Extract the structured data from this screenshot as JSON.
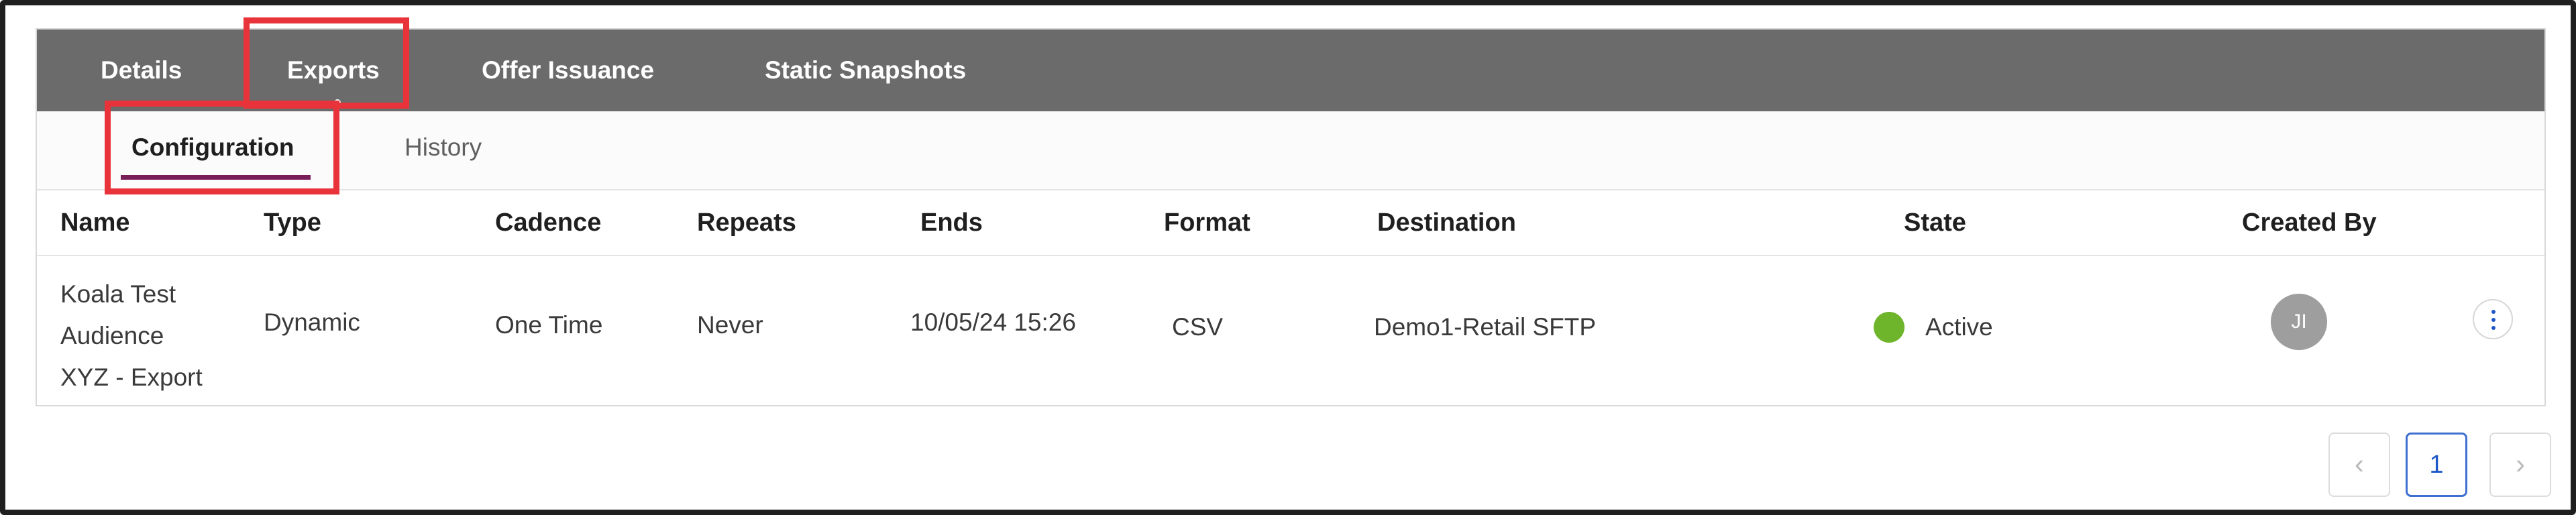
{
  "top_tabs": [
    {
      "label": "Details"
    },
    {
      "label": "Exports"
    },
    {
      "label": "Offer Issuance"
    },
    {
      "label": "Static Snapshots"
    }
  ],
  "sub_tabs": [
    {
      "label": "Configuration"
    },
    {
      "label": "History"
    }
  ],
  "table": {
    "columns": [
      "Name",
      "Type",
      "Cadence",
      "Repeats",
      "Ends",
      "Format",
      "Destination",
      "State",
      "Created By"
    ],
    "rows": [
      {
        "name_lines": [
          "Koala Test",
          "Audience",
          "XYZ - Export"
        ],
        "type": "Dynamic",
        "cadence": "One Time",
        "repeats": "Never",
        "ends": "10/05/24 15:26",
        "format": "CSV",
        "destination": "Demo1-Retail SFTP",
        "state": "Active",
        "created_by_initials": "JI"
      }
    ]
  },
  "pagination": {
    "prev_icon": "‹",
    "current_page": "1",
    "next_icon": "›"
  },
  "colors": {
    "topnav_bg": "#6b6b6b",
    "highlight": "#e8333a",
    "active_underline": "#7a1e5a",
    "state_active": "#6fb52c",
    "link_blue": "#1f56c7"
  }
}
